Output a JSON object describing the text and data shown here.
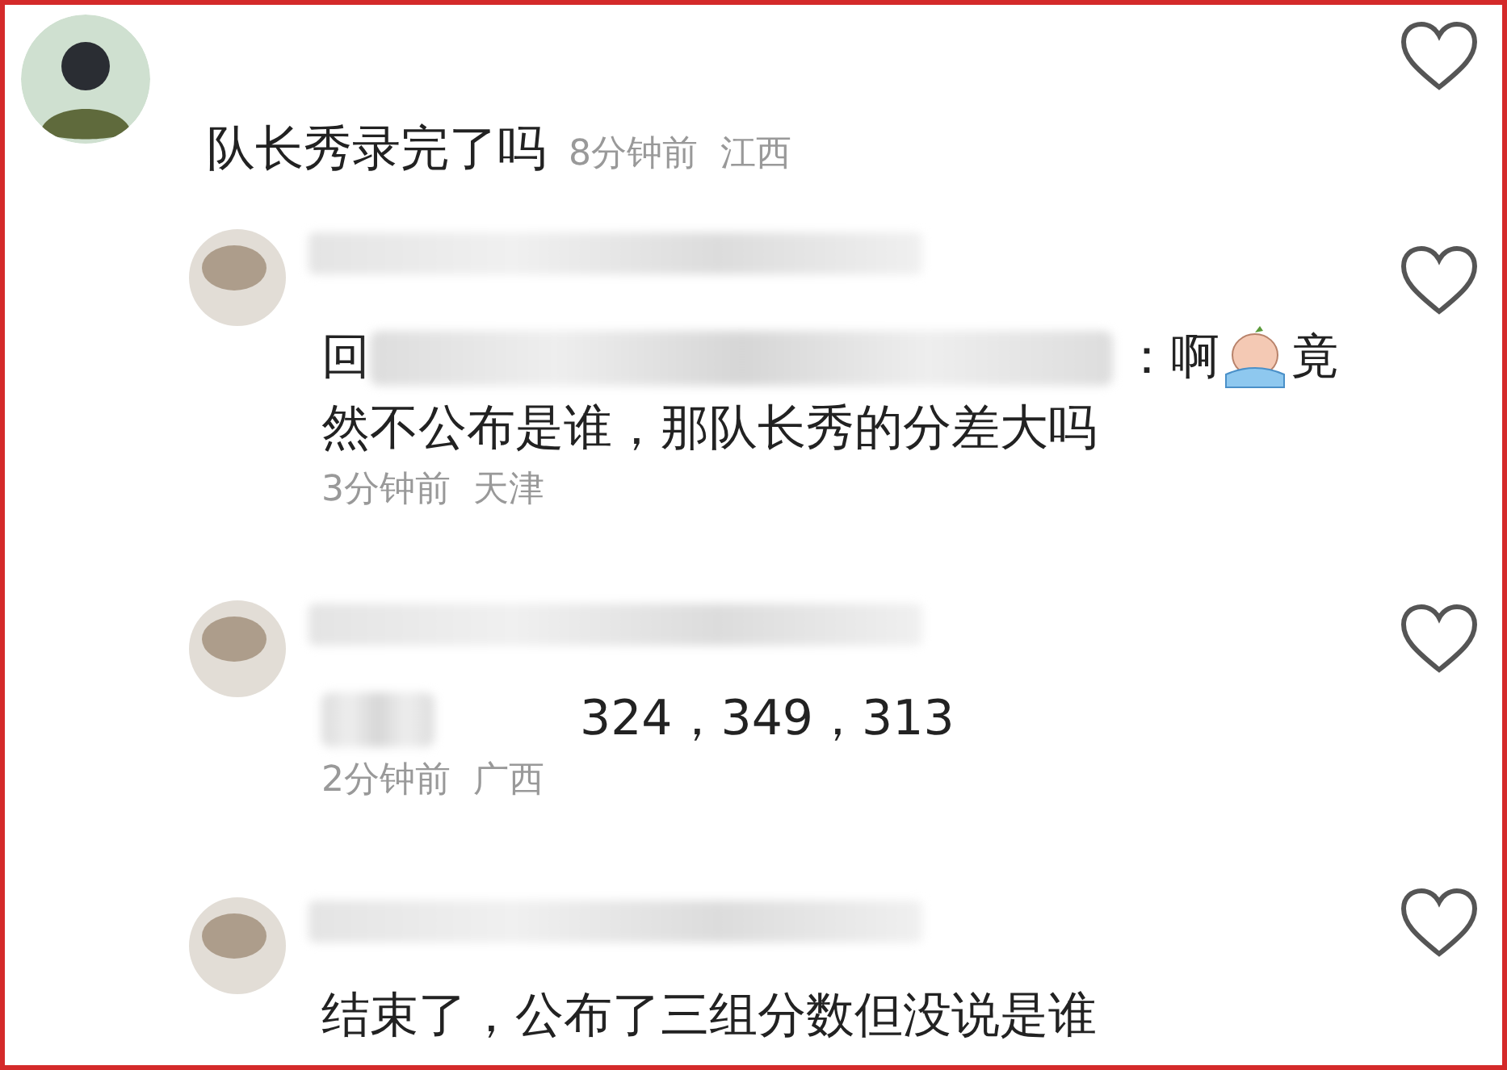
{
  "comments": [
    {
      "kind": "top",
      "lines": [
        [
          {
            "kind": "text",
            "text": "队长秀录完了吗"
          }
        ]
      ],
      "time": "8分钟前",
      "location": "江西",
      "liked": false
    },
    {
      "kind": "reply",
      "lines": [
        [
          {
            "kind": "text",
            "text": "回"
          },
          {
            "kind": "blur"
          },
          {
            "kind": "text",
            "text": "：啊"
          },
          {
            "kind": "emoji"
          },
          {
            "kind": "text",
            "text": "竟"
          }
        ],
        [
          {
            "kind": "text",
            "text": "然不公布是谁，那队长秀的分差大吗"
          }
        ]
      ],
      "time": "3分钟前",
      "location": "天津",
      "liked": false
    },
    {
      "kind": "reply",
      "lines": [
        [
          {
            "kind": "blur"
          },
          {
            "kind": "text",
            "text": "324，349，313"
          }
        ]
      ],
      "time": "2分钟前",
      "location": "广西",
      "liked": false
    },
    {
      "kind": "reply",
      "lines": [
        [
          {
            "kind": "text",
            "text": "结束了，公布了三组分数但没说是谁"
          }
        ]
      ],
      "liked": false
    }
  ]
}
